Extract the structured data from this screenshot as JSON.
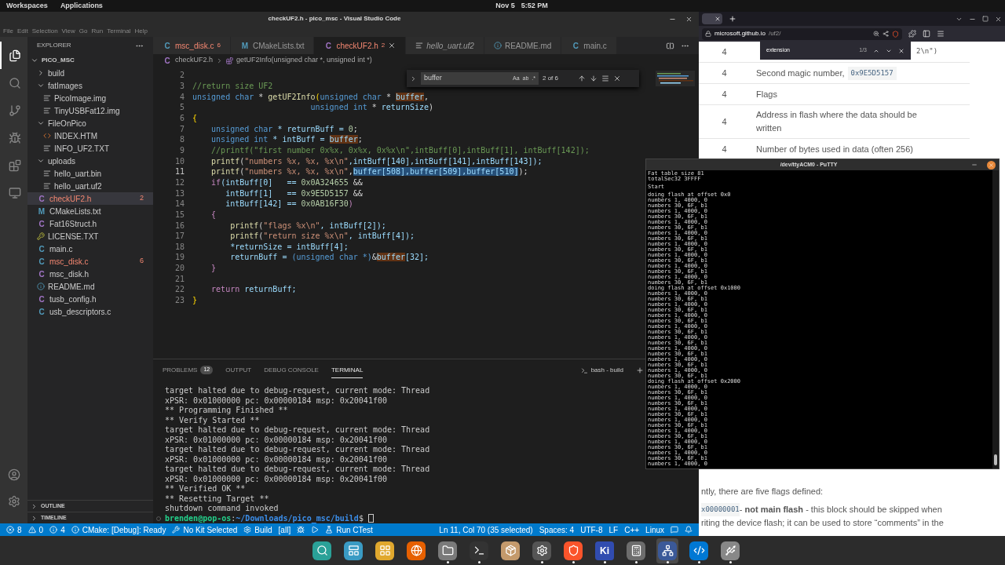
{
  "top_bar": {
    "workspaces": "Workspaces",
    "applications": "Applications",
    "date": "Nov 5",
    "time": "5:52 PM"
  },
  "vscode": {
    "title": "checkUF2.h - pico_msc - Visual Studio Code",
    "menu": [
      "File",
      "Edit",
      "Selection",
      "View",
      "Go",
      "Run",
      "Terminal",
      "Help"
    ],
    "activity": [
      {
        "kind": "explorer",
        "selected": true
      },
      {
        "kind": "search",
        "selected": false
      },
      {
        "kind": "scm",
        "selected": false
      },
      {
        "kind": "debug",
        "selected": false
      },
      {
        "kind": "extensions",
        "selected": false
      },
      {
        "kind": "remote",
        "selected": false
      }
    ],
    "sidebar": {
      "title": "EXPLORER",
      "root": "PICO_MSC",
      "tree": [
        {
          "name": "build",
          "kind": "folder",
          "expanded": false,
          "selected": false,
          "error": false
        },
        {
          "name": "fatImages",
          "kind": "folder",
          "expanded": true,
          "selected": false,
          "error": false,
          "children": [
            {
              "name": "PicoImage.img",
              "kind": "text",
              "selected": false,
              "error": false
            },
            {
              "name": "TinyUSBFat12.img",
              "kind": "text",
              "selected": false,
              "error": false
            }
          ]
        },
        {
          "name": "FileOnPico",
          "kind": "folder",
          "expanded": true,
          "selected": false,
          "error": false,
          "children": [
            {
              "name": "INDEX.HTM",
              "kind": "html",
              "selected": false,
              "error": false
            },
            {
              "name": "INFO_UF2.TXT",
              "kind": "text",
              "selected": false,
              "error": false
            }
          ]
        },
        {
          "name": "uploads",
          "kind": "folder",
          "expanded": true,
          "selected": false,
          "error": false,
          "children": [
            {
              "name": "hello_uart.bin",
              "kind": "text",
              "selected": false,
              "error": false
            },
            {
              "name": "hello_uart.uf2",
              "kind": "text",
              "selected": false,
              "error": false
            }
          ]
        },
        {
          "name": "checkUF2.h",
          "kind": "header",
          "glyph": "C",
          "badge": "2",
          "selected": true,
          "error": true
        },
        {
          "name": "CMakeLists.txt",
          "kind": "cmake",
          "glyph": "M",
          "selected": false,
          "error": false
        },
        {
          "name": "Fat16Struct.h",
          "kind": "header",
          "glyph": "C",
          "selected": false,
          "error": false
        },
        {
          "name": "LICENSE.TXT",
          "kind": "license",
          "selected": false,
          "error": false
        },
        {
          "name": "main.c",
          "kind": "source",
          "glyph": "C",
          "selected": false,
          "error": false
        },
        {
          "name": "msc_disk.c",
          "kind": "source",
          "glyph": "C",
          "badge": "6",
          "selected": false,
          "error": true
        },
        {
          "name": "msc_disk.h",
          "kind": "header",
          "glyph": "C",
          "selected": false,
          "error": false
        },
        {
          "name": "README.md",
          "kind": "info",
          "selected": false,
          "error": false
        },
        {
          "name": "tusb_config.h",
          "kind": "header",
          "glyph": "C",
          "selected": false,
          "error": false
        },
        {
          "name": "usb_descriptors.c",
          "kind": "source",
          "glyph": "C",
          "selected": false,
          "error": false
        }
      ],
      "sections": [
        {
          "label": "OUTLINE",
          "expanded": false
        },
        {
          "label": "TIMELINE",
          "expanded": false
        }
      ]
    },
    "tabs": [
      {
        "label": "msc_disk.c",
        "kind": "source",
        "glyph": "C",
        "badge": "6",
        "error": true,
        "preview": false,
        "selected": false
      },
      {
        "label": "CMakeLists.txt",
        "kind": "cmake",
        "glyph": "M",
        "error": false,
        "preview": false,
        "selected": false
      },
      {
        "label": "checkUF2.h",
        "kind": "header",
        "glyph": "C",
        "badge": "2",
        "error": true,
        "preview": false,
        "selected": true
      },
      {
        "label": "hello_uart.uf2",
        "kind": "text",
        "error": false,
        "preview": true,
        "selected": false
      },
      {
        "label": "README.md",
        "kind": "info",
        "error": false,
        "preview": false,
        "selected": false
      },
      {
        "label": "main.c",
        "kind": "source",
        "glyph": "C",
        "error": false,
        "preview": false,
        "selected": false
      }
    ],
    "breadcrumbs": [
      {
        "label": "checkUF2.h",
        "kind": "file",
        "glyph": "C"
      },
      {
        "label": "getUF2Info(unsigned char *, unsigned int *)",
        "kind": "function"
      }
    ],
    "find": {
      "value": "buffer",
      "options": [
        "Aa",
        "ab",
        ".*"
      ],
      "count": "2 of 6"
    },
    "code": [
      {
        "number": "2",
        "current": false
      },
      {
        "number": "3",
        "current": false,
        "tokens": [
          {
            "text": "//return size UF2",
            "kind": "comment"
          }
        ]
      },
      {
        "number": "4",
        "current": false,
        "tokens": [
          {
            "text": "unsigned char",
            "kind": "kw"
          },
          {
            "text": " * ",
            "kind": "plain"
          },
          {
            "text": "getUF2Info",
            "kind": "fn"
          },
          {
            "text": "(",
            "kind": "punct"
          },
          {
            "text": "unsigned char",
            "kind": "kw"
          },
          {
            "text": " * ",
            "kind": "plain"
          },
          {
            "text": "buffer",
            "kind": "match"
          },
          {
            "text": ",",
            "kind": "plain"
          }
        ]
      },
      {
        "number": "5",
        "current": false,
        "tokens": [
          {
            "text": "                         unsigned int",
            "kind": "kw"
          },
          {
            "text": " * ",
            "kind": "plain"
          },
          {
            "text": "returnSize",
            "kind": "var"
          },
          {
            "text": ")",
            "kind": "plain"
          }
        ]
      },
      {
        "number": "6",
        "current": false,
        "tokens": [
          {
            "text": "{",
            "kind": "punct"
          }
        ]
      },
      {
        "number": "7",
        "current": false,
        "tokens": [
          {
            "text": "    unsigned char",
            "kind": "kw"
          },
          {
            "text": " * returnBuff = ",
            "kind": "var"
          },
          {
            "text": "0",
            "kind": "num"
          },
          {
            "text": ";",
            "kind": "plain"
          }
        ]
      },
      {
        "number": "8",
        "current": false,
        "tokens": [
          {
            "text": "    unsigned int",
            "kind": "kw"
          },
          {
            "text": " * intBuff = ",
            "kind": "var"
          },
          {
            "text": "buffer",
            "kind": "match"
          },
          {
            "text": ";",
            "kind": "plain"
          }
        ]
      },
      {
        "number": "9",
        "current": false,
        "tokens": [
          {
            "text": "    //printf(\"first number 0x%x, 0x%x, 0x%x\\n\",intBuff[0],intBuff[1], intBuff[142]);",
            "kind": "comment"
          }
        ]
      },
      {
        "number": "10",
        "current": false,
        "tokens": [
          {
            "text": "    printf",
            "kind": "fn"
          },
          {
            "text": "(",
            "kind": "plain"
          },
          {
            "text": "\"numbers %x, %x, %x\\n\"",
            "kind": "str"
          },
          {
            "text": ",intBuff[140],intBuff[141],intBuff[143]);",
            "kind": "var"
          }
        ]
      },
      {
        "number": "11",
        "current": true,
        "tokens": [
          {
            "text": "    printf",
            "kind": "fn"
          },
          {
            "text": "(",
            "kind": "plain"
          },
          {
            "text": "\"numbers %x, %x, %x\\n\"",
            "kind": "str"
          },
          {
            "text": ",",
            "kind": "plain"
          },
          {
            "text": "buffer[508],buffer[509],buffer[510]",
            "kind": "selected"
          },
          {
            "text": ");",
            "kind": "plain"
          }
        ]
      },
      {
        "number": "12",
        "current": false,
        "tokens": [
          {
            "text": "    if",
            "kind": "ctrl"
          },
          {
            "text": "(intBuff[0]   == ",
            "kind": "var"
          },
          {
            "text": "0x0A324655",
            "kind": "num"
          },
          {
            "text": " &&",
            "kind": "plain"
          }
        ]
      },
      {
        "number": "13",
        "current": false,
        "tokens": [
          {
            "text": "       intBuff[1]   == ",
            "kind": "var"
          },
          {
            "text": "0x9E5D5157",
            "kind": "num"
          },
          {
            "text": " &&",
            "kind": "plain"
          }
        ]
      },
      {
        "number": "14",
        "current": false,
        "tokens": [
          {
            "text": "       intBuff[142] == ",
            "kind": "var"
          },
          {
            "text": "0x0AB16F30",
            "kind": "num"
          },
          {
            "text": ")",
            "kind": "ctrl"
          }
        ]
      },
      {
        "number": "15",
        "current": false,
        "tokens": [
          {
            "text": "    {",
            "kind": "ctrl"
          }
        ]
      },
      {
        "number": "16",
        "current": false,
        "tokens": [
          {
            "text": "        printf",
            "kind": "fn"
          },
          {
            "text": "(",
            "kind": "plain"
          },
          {
            "text": "\"flags %x\\n\"",
            "kind": "str"
          },
          {
            "text": ", intBuff[2]);",
            "kind": "var"
          }
        ]
      },
      {
        "number": "17",
        "current": false,
        "tokens": [
          {
            "text": "        printf",
            "kind": "fn"
          },
          {
            "text": "(",
            "kind": "plain"
          },
          {
            "text": "\"return size %x\\n\"",
            "kind": "str"
          },
          {
            "text": ", intBuff[4]);",
            "kind": "var"
          }
        ]
      },
      {
        "number": "18",
        "current": false,
        "tokens": [
          {
            "text": "        *returnSize = intBuff[4];",
            "kind": "var"
          }
        ]
      },
      {
        "number": "19",
        "current": false,
        "tokens": [
          {
            "text": "        returnBuff = ",
            "kind": "var"
          },
          {
            "text": "(unsigned char *)",
            "kind": "kw"
          },
          {
            "text": "&",
            "kind": "plain"
          },
          {
            "text": "buffer",
            "kind": "match"
          },
          {
            "text": "[32];",
            "kind": "var"
          }
        ]
      },
      {
        "number": "20",
        "current": false,
        "tokens": [
          {
            "text": "    }",
            "kind": "ctrl"
          }
        ]
      },
      {
        "number": "21",
        "current": false
      },
      {
        "number": "22",
        "current": false,
        "tokens": [
          {
            "text": "    return",
            "kind": "ctrl"
          },
          {
            "text": " returnBuff;",
            "kind": "var"
          }
        ]
      },
      {
        "number": "23",
        "current": false,
        "tokens": [
          {
            "text": "}",
            "kind": "punct"
          }
        ]
      }
    ],
    "panel_tabs": [
      {
        "label": "PROBLEMS",
        "badge": "12",
        "selected": false
      },
      {
        "label": "OUTPUT",
        "selected": false
      },
      {
        "label": "DEBUG CONSOLE",
        "selected": false
      },
      {
        "label": "TERMINAL",
        "selected": true
      }
    ],
    "shell": "bash - build",
    "terminal": [
      "target halted due to debug-request, current mode: Thread",
      "xPSR: 0x01000000 pc: 0x00000184 msp: 0x20041f00",
      "** Programming Finished **",
      "** Verify Started **",
      "target halted due to debug-request, current mode: Thread",
      "xPSR: 0x01000000 pc: 0x00000184 msp: 0x20041f00",
      "target halted due to debug-request, current mode: Thread",
      "xPSR: 0x01000000 pc: 0x00000184 msp: 0x20041f00",
      "target halted due to debug-request, current mode: Thread",
      "xPSR: 0x01000000 pc: 0x00000184 msp: 0x20041f00",
      "** Verified OK **",
      "** Resetting Target **",
      "shutdown command invoked"
    ],
    "prompt": {
      "user": "brenden@pop-os",
      "sep": ":",
      "path": "~/Downloads/pico_msc/build",
      "sign": "$"
    },
    "status_left": [
      {
        "kind": "errors",
        "text": "8"
      },
      {
        "kind": "warnings",
        "text": "0"
      },
      {
        "kind": "infos",
        "text": "4"
      },
      {
        "kind": "cmake",
        "text": "CMake: [Debug]: Ready"
      },
      {
        "kind": "kit",
        "text": "No Kit Selected"
      },
      {
        "kind": "build",
        "text": "Build"
      },
      {
        "kind": "plain",
        "text": "[all]"
      },
      {
        "kind": "bug"
      },
      {
        "kind": "run"
      },
      {
        "kind": "test",
        "text": "Run CTest"
      }
    ],
    "status_right": [
      {
        "kind": "plain",
        "text": "Ln 11, Col 70 (35 selected)"
      },
      {
        "kind": "plain",
        "text": "Spaces: 4"
      },
      {
        "kind": "plain",
        "text": "UTF-8"
      },
      {
        "kind": "plain",
        "text": "LF"
      },
      {
        "kind": "plain",
        "text": "C++"
      },
      {
        "kind": "plain",
        "text": "Linux"
      },
      {
        "kind": "feedback"
      },
      {
        "kind": "bell"
      }
    ]
  },
  "browser": {
    "url_host": "microsoft.github.io",
    "url_path": "/uf2/",
    "find": {
      "value": "extension",
      "count": "1/3"
    },
    "table": [
      {
        "size": "4",
        "description": "2\\n\")",
        "covered": true
      },
      {
        "size": "4",
        "description": "Second magic number,",
        "code": "0x9E5D5157",
        "covered": false
      },
      {
        "size": "4",
        "description": "Flags",
        "covered": false
      },
      {
        "size": "4",
        "description": "Address in flash where the data should be written",
        "covered": false
      },
      {
        "size": "4",
        "description": "Number of bytes used in data (often 256)",
        "covered": false
      }
    ],
    "intro": "ntly, there are five flags defined:",
    "flag_code": "x00000001",
    "flag_text": " - **not main flash** - this block should be skipped when",
    "flag_text2": "riting the device flash; it can be used to store “comments” in the"
  },
  "putty": {
    "title": "/dev/ttyACM0 - PuTTY",
    "blocks": [
      [
        "Fat table size 81",
        "totalSec32 3FFFF"
      ],
      [
        "Start"
      ],
      [
        "doing flash at offset 0x0",
        "numbers 1, 4000, 0",
        "numbers 30, 6F, b1",
        "numbers 1, 4000, 0",
        "numbers 30, 6F, b1",
        "numbers 1, 4000, 0",
        "numbers 30, 6F, b1",
        "numbers 1, 4000, 0",
        "numbers 30, 6F, b1",
        "numbers 1, 4000, 0",
        "numbers 30, 6F, b1",
        "numbers 1, 4000, 0",
        "numbers 30, 6F, b1",
        "numbers 1, 4000, 0",
        "numbers 30, 6F, b1",
        "numbers 1, 4000, 0",
        "numbers 30, 6F, b1",
        "doing flash at offset 0x1000",
        "numbers 1, 4000, 0",
        "numbers 30, 6F, b1",
        "numbers 1, 4000, 0",
        "numbers 30, 6F, b1",
        "numbers 1, 4000, 0",
        "numbers 30, 6F, b1",
        "numbers 1, 4000, 0",
        "numbers 30, 6F, b1",
        "numbers 1, 4000, 0",
        "numbers 30, 6F, b1",
        "numbers 1, 4000, 0",
        "numbers 30, 6F, b1",
        "numbers 1, 4000, 0",
        "numbers 30, 6F, b1",
        "numbers 1, 4000, 0",
        "numbers 30, 6F, b1",
        "doing flash at offset 0x2000",
        "numbers 1, 4000, 0",
        "numbers 30, 6F, b1",
        "numbers 1, 4000, 0",
        "numbers 30, 6F, b1",
        "numbers 1, 4000, 0",
        "numbers 30, 6F, b1",
        "numbers 1, 4000, 0",
        "numbers 30, 6F, b1",
        "numbers 1, 4000, 0",
        "numbers 30, 6F, b1",
        "numbers 1, 4000, 0",
        "numbers 30, 6F, b1",
        "numbers 1, 4000, 0",
        "numbers 30, 6F, b1",
        "numbers 1, 4000, 0"
      ]
    ]
  },
  "dock": [
    {
      "kind": "search",
      "running": false,
      "selected": false
    },
    {
      "kind": "windows",
      "running": false,
      "selected": false
    },
    {
      "kind": "apps",
      "running": false,
      "selected": false
    },
    {
      "kind": "browser",
      "running": false,
      "selected": false
    },
    {
      "kind": "files",
      "running": true,
      "selected": false
    },
    {
      "kind": "terminal",
      "running": true,
      "selected": false
    },
    {
      "kind": "archive",
      "running": false,
      "selected": false
    },
    {
      "kind": "settings",
      "running": true,
      "selected": false
    },
    {
      "kind": "shield",
      "running": true,
      "selected": false
    },
    {
      "kind": "letters",
      "label": "Ki",
      "running": true,
      "selected": false
    },
    {
      "kind": "calculator",
      "running": true,
      "selected": false
    },
    {
      "kind": "network",
      "running": true,
      "selected": true
    },
    {
      "kind": "code",
      "running": true,
      "selected": false
    },
    {
      "kind": "usb",
      "running": true,
      "selected": false
    }
  ]
}
